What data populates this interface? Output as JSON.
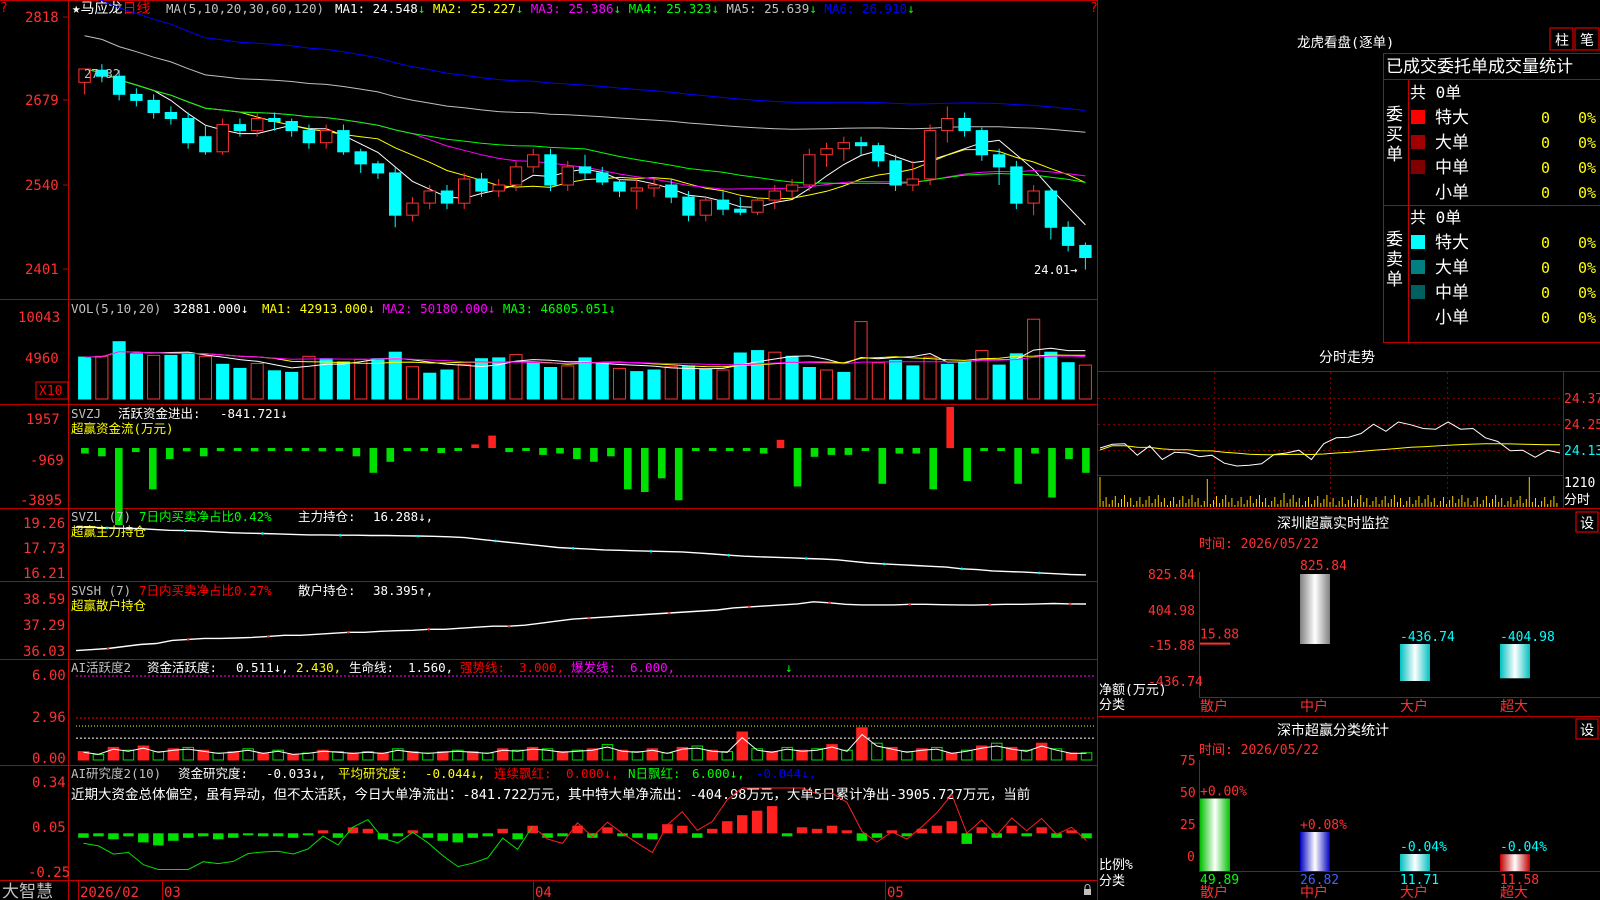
{
  "main_chart": {
    "name": "马应龙",
    "period": "日线",
    "ma_params": "MA(5,10,20,30,60,120)",
    "ma_values": [
      {
        "label": "MA1:",
        "value": "24.548",
        "arrow": "↓",
        "color": "#ffffff"
      },
      {
        "label": "MA2:",
        "value": "25.227",
        "arrow": "↓",
        "color": "#ffff00"
      },
      {
        "label": "MA3:",
        "value": "25.386",
        "arrow": "↓",
        "color": "#ff00ff"
      },
      {
        "label": "MA4:",
        "value": "25.323",
        "arrow": "↓",
        "color": "#00ff00"
      },
      {
        "label": "MA5:",
        "value": "25.639",
        "arrow": "↓",
        "color": "#c0c0c0"
      },
      {
        "label": "MA6:",
        "value": "26.910",
        "arrow": "↓",
        "color": "#0000ff"
      }
    ],
    "y_ticks": [
      "2818",
      "2679",
      "2540",
      "2401"
    ],
    "high_label": "27.32",
    "low_label": "24.01→"
  },
  "vol_panel": {
    "title": "VOL(5,10,20)",
    "value": "32881.000↓",
    "ma": [
      {
        "label": "MA1:",
        "value": "42913.000↓",
        "color": "#ffff00"
      },
      {
        "label": "MA2:",
        "value": "50180.000↓",
        "color": "#ff00ff"
      },
      {
        "label": "MA3:",
        "value": "46805.051↓",
        "color": "#00ff00"
      }
    ],
    "y_ticks": [
      "10043",
      "4960"
    ],
    "unit_badge": "X10"
  },
  "svzj_panel": {
    "title": "SVZJ",
    "label": "活跃资金进出:",
    "value": "-841.721↓",
    "subtitle": "超赢资金流(万元)",
    "y_ticks": [
      "1957",
      "-969",
      "-3895"
    ]
  },
  "svzl_panel": {
    "title": "SVZL (7)",
    "label1": "7日内买卖净占比0.42%",
    "label2": "主力持仓:",
    "value": "16.288↓,",
    "subtitle": "超赢主力持仓",
    "y_ticks": [
      "19.26",
      "17.73",
      "16.21"
    ]
  },
  "svsh_panel": {
    "title": "SVSH (7)",
    "label1": "7日内买卖净占比0.27%",
    "label2": "散户持仓:",
    "value": "38.395↑,",
    "subtitle": "超赢散户持仓",
    "y_ticks": [
      "38.59",
      "37.29",
      "36.03"
    ]
  },
  "ai_active_panel": {
    "title": "AI活跃度2",
    "label1": "资金活跃度:",
    "value1": "0.511↓,",
    "value2": "2.430,",
    "label3": "生命线:",
    "value3": "1.560,",
    "label4": "强势线:",
    "value4": "3.000,",
    "label5": "爆发线:",
    "value5": "6.000,",
    "arrow": "↓",
    "y_ticks": [
      "6.00",
      "2.96",
      "0.00"
    ]
  },
  "ai_research_panel": {
    "title": "AI研究度2(10)",
    "label1": "资金研究度:",
    "value1": "-0.033↓,",
    "label2": "平均研究度:",
    "value2": "-0.044↓,",
    "label3": "连续飘红:",
    "value3": "0.000↓,",
    "label4": "N日飘红:",
    "value4": "6.000↓,",
    "value5": "-0.044↓,",
    "commentary": "近期大资金总体偏空，虽有异动，但不太活跃，今日大单净流出：-841.722万元，其中特大单净流出：-404.98万元，大单5日累计净出-3905.727万元，当前",
    "y_ticks": [
      "0.34",
      "0.05",
      "-0.25"
    ]
  },
  "x_axis": {
    "logo": "大智慧",
    "labels": [
      "2026/02",
      "03",
      "04",
      "05"
    ]
  },
  "dragon_tiger": {
    "title": "龙虎看盘(逐单)",
    "btn_bar": "柱",
    "btn_pen": "笔",
    "header": "已成交委托单成交量统计",
    "buy": {
      "side_label": "委买单",
      "total": "共 0单",
      "rows": [
        {
          "label": "特大",
          "count": "0",
          "pct": "0%",
          "color": "#ff0000"
        },
        {
          "label": "大单",
          "count": "0",
          "pct": "0%",
          "color": "#a00000"
        },
        {
          "label": "中单",
          "count": "0",
          "pct": "0%",
          "color": "#800000"
        },
        {
          "label": "小单",
          "count": "0",
          "pct": "0%",
          "color": ""
        }
      ]
    },
    "sell": {
      "side_label": "委卖单",
      "total": "共 0单",
      "rows": [
        {
          "label": "特大",
          "count": "0",
          "pct": "0%",
          "color": "#00ffff"
        },
        {
          "label": "大单",
          "count": "0",
          "pct": "0%",
          "color": "#008080"
        },
        {
          "label": "中单",
          "count": "0",
          "pct": "0%",
          "color": "#006060"
        },
        {
          "label": "小单",
          "count": "0",
          "pct": "0%",
          "color": ""
        }
      ]
    }
  },
  "intraday": {
    "title": "分时走势",
    "y_ticks": [
      "24.37",
      "24.25",
      "24.13"
    ],
    "vol_tick": "1210",
    "vol_label": "分时"
  },
  "sz_monitor": {
    "title": "深圳超赢实时监控",
    "btn": "设",
    "time": "时间: 2026/05/22",
    "y_ticks": [
      "825.84",
      "404.98",
      "-15.88",
      "-436.74"
    ],
    "y_unit": "净额(万元)",
    "y_unit2": "分类",
    "categories": [
      "散户",
      "中户",
      "大户",
      "超大"
    ]
  },
  "sz_class": {
    "title": "深市超赢分类统计",
    "btn": "设",
    "time": "时间: 2026/05/22",
    "y_ticks": [
      "75",
      "50",
      "25",
      "0"
    ],
    "y_unit": "比例%",
    "y_unit2": "分类",
    "categories": [
      "散户",
      "中户",
      "大户",
      "超大"
    ]
  },
  "chart_data": [
    {
      "type": "candlestick",
      "title": "马应龙 日线",
      "ylim": [
        24.01,
        28.18
      ],
      "annotations": [
        "27.32",
        "24.01"
      ],
      "x_labels": [
        "2026/02",
        "03",
        "04",
        "05"
      ],
      "ohlc": [
        [
          27.1,
          27.3,
          26.9,
          27.32
        ],
        [
          27.3,
          27.4,
          27.1,
          27.2
        ],
        [
          27.2,
          27.3,
          26.8,
          26.9
        ],
        [
          26.9,
          27.0,
          26.7,
          26.8
        ],
        [
          26.8,
          26.9,
          26.5,
          26.6
        ],
        [
          26.6,
          26.7,
          26.4,
          26.5
        ],
        [
          26.5,
          26.6,
          26.0,
          26.1
        ],
        [
          26.2,
          26.4,
          25.9,
          25.95
        ],
        [
          25.95,
          26.5,
          25.9,
          26.4
        ],
        [
          26.4,
          26.5,
          26.2,
          26.3
        ],
        [
          26.3,
          26.6,
          26.2,
          26.5
        ],
        [
          26.5,
          26.6,
          26.3,
          26.45
        ],
        [
          26.45,
          26.5,
          26.2,
          26.3
        ],
        [
          26.3,
          26.4,
          26.0,
          26.1
        ],
        [
          26.1,
          26.4,
          26.0,
          26.3
        ],
        [
          26.3,
          26.4,
          25.9,
          25.95
        ],
        [
          25.95,
          26.0,
          25.6,
          25.75
        ],
        [
          25.75,
          25.8,
          25.5,
          25.6
        ],
        [
          25.6,
          25.7,
          24.7,
          24.9
        ],
        [
          24.9,
          25.2,
          24.8,
          25.1
        ],
        [
          25.1,
          25.4,
          25.0,
          25.3
        ],
        [
          25.3,
          25.4,
          25.0,
          25.1
        ],
        [
          25.1,
          25.6,
          25.0,
          25.5
        ],
        [
          25.5,
          25.6,
          25.2,
          25.3
        ],
        [
          25.3,
          25.5,
          25.2,
          25.4
        ],
        [
          25.4,
          25.8,
          25.3,
          25.7
        ],
        [
          25.7,
          26.0,
          25.6,
          25.9
        ],
        [
          25.9,
          26.0,
          25.3,
          25.4
        ],
        [
          25.4,
          25.8,
          25.3,
          25.7
        ],
        [
          25.7,
          25.9,
          25.5,
          25.6
        ],
        [
          25.6,
          25.7,
          25.4,
          25.45
        ],
        [
          25.45,
          25.5,
          25.2,
          25.3
        ],
        [
          25.3,
          25.5,
          25.0,
          25.35
        ],
        [
          25.35,
          25.5,
          25.2,
          25.4
        ],
        [
          25.4,
          25.5,
          25.1,
          25.2
        ],
        [
          25.2,
          25.3,
          24.8,
          24.9
        ],
        [
          24.9,
          25.2,
          24.8,
          25.15
        ],
        [
          25.15,
          25.3,
          24.9,
          25.0
        ],
        [
          25.0,
          25.2,
          24.9,
          24.95
        ],
        [
          24.95,
          25.2,
          24.9,
          25.15
        ],
        [
          25.15,
          25.4,
          25.0,
          25.3
        ],
        [
          25.3,
          25.5,
          25.2,
          25.4
        ],
        [
          25.4,
          26.0,
          25.3,
          25.9
        ],
        [
          25.9,
          26.1,
          25.7,
          26.0
        ],
        [
          26.0,
          26.2,
          25.8,
          26.1
        ],
        [
          26.1,
          26.2,
          25.9,
          26.05
        ],
        [
          26.05,
          26.1,
          25.7,
          25.8
        ],
        [
          25.8,
          25.9,
          25.3,
          25.4
        ],
        [
          25.4,
          25.8,
          25.3,
          25.5
        ],
        [
          25.5,
          26.4,
          25.4,
          26.3
        ],
        [
          26.3,
          26.7,
          26.1,
          26.5
        ],
        [
          26.5,
          26.6,
          26.2,
          26.3
        ],
        [
          26.3,
          26.35,
          25.8,
          25.9
        ],
        [
          25.9,
          26.0,
          25.4,
          25.7
        ],
        [
          25.7,
          25.8,
          25.0,
          25.1
        ],
        [
          25.1,
          25.4,
          24.9,
          25.3
        ],
        [
          25.3,
          25.35,
          24.5,
          24.7
        ],
        [
          24.7,
          24.8,
          24.3,
          24.4
        ],
        [
          24.4,
          24.45,
          24.0,
          24.2
        ]
      ]
    },
    {
      "type": "bar",
      "title": "VOL(5,10,20)",
      "ylim": [
        0,
        10043
      ],
      "values": [
        5200,
        5300,
        7100,
        5600,
        5400,
        5400,
        5600,
        5300,
        4300,
        3800,
        4400,
        3500,
        3300,
        5300,
        5000,
        4600,
        4900,
        5000,
        5800,
        4000,
        3200,
        3600,
        4300,
        5000,
        5100,
        5500,
        4500,
        3900,
        4100,
        5100,
        4500,
        3800,
        3400,
        3600,
        4000,
        4100,
        3700,
        3600,
        5700,
        6000,
        5800,
        5300,
        3900,
        3600,
        3300,
        9600,
        4500,
        4800,
        4100,
        5200,
        4300,
        4600,
        6000,
        4200,
        5600,
        9900,
        5800,
        4500,
        4200
      ]
    },
    {
      "type": "bar",
      "title": "超赢资金流(万元)",
      "ylim": [
        -3895,
        1957
      ],
      "values": [
        -200,
        -300,
        -2800,
        -150,
        -1500,
        -400,
        -120,
        -300,
        -80,
        -20,
        -120,
        -50,
        -10,
        -50,
        -120,
        -100,
        -300,
        -900,
        -500,
        -50,
        -100,
        -180,
        -80,
        130,
        450,
        -150,
        -100,
        -250,
        -200,
        -400,
        -500,
        -300,
        -1500,
        -1600,
        -1100,
        -1900,
        -100,
        -40,
        -100,
        -100,
        -200,
        300,
        -1400,
        -320,
        -250,
        -250,
        -100,
        -1300,
        -200,
        -200,
        -1500,
        1500,
        -1200,
        -40,
        -100,
        -1300,
        -200,
        -1800,
        -400,
        -900
      ]
    },
    {
      "type": "line",
      "title": "超赢主力持仓",
      "ylim": [
        16.21,
        19.26
      ],
      "values": [
        19.2,
        19.18,
        19.15,
        19.12,
        19.1,
        19.05,
        19.0,
        18.98,
        18.95,
        18.9,
        18.85,
        18.82,
        18.8,
        18.78,
        18.75,
        18.72,
        18.72,
        18.7,
        18.7,
        18.68,
        18.68,
        18.66,
        18.65,
        18.63,
        18.6,
        18.55,
        18.45,
        18.35,
        18.25,
        18.15,
        18.05,
        17.95,
        17.9,
        17.85,
        17.8,
        17.78,
        17.75,
        17.72,
        17.7,
        17.68,
        17.62,
        17.55,
        17.48,
        17.42,
        17.38,
        17.35,
        17.32,
        17.28,
        17.25,
        17.2,
        17.1,
        17.0,
        16.95,
        16.9,
        16.85,
        16.8,
        16.75,
        16.65,
        16.6,
        16.52,
        16.48,
        16.45,
        16.4,
        16.35,
        16.3,
        16.28
      ]
    },
    {
      "type": "line",
      "title": "超赢散户持仓",
      "ylim": [
        36.03,
        38.59
      ],
      "values": [
        36.1,
        36.15,
        36.2,
        36.3,
        36.4,
        36.45,
        36.6,
        36.65,
        36.7,
        36.7,
        36.72,
        36.75,
        36.8,
        36.85,
        36.85,
        36.9,
        36.95,
        37.0,
        37.0,
        37.05,
        37.08,
        37.1,
        37.15,
        37.15,
        37.2,
        37.25,
        37.3,
        37.3,
        37.35,
        37.45,
        37.55,
        37.65,
        37.7,
        37.75,
        37.8,
        37.85,
        37.9,
        37.95,
        38.0,
        38.05,
        38.1,
        38.2,
        38.25,
        38.3,
        38.35,
        38.4,
        38.5,
        38.45,
        38.38,
        38.35,
        38.35,
        38.35,
        38.38,
        38.38,
        38.36,
        38.35,
        38.34,
        38.36,
        38.38,
        38.38,
        38.4,
        38.42,
        38.4,
        38.395
      ]
    },
    {
      "type": "bar",
      "title": "AI活跃度2",
      "ylim": [
        0,
        6.0
      ],
      "values": [
        0.6,
        0.4,
        0.9,
        0.7,
        1.0,
        0.6,
        0.8,
        0.9,
        0.7,
        0.5,
        0.6,
        0.8,
        0.5,
        0.7,
        0.4,
        0.5,
        0.7,
        0.6,
        0.5,
        0.6,
        0.5,
        0.8,
        0.6,
        0.5,
        0.6,
        0.7,
        0.6,
        0.5,
        0.8,
        0.7,
        0.9,
        0.8,
        0.6,
        0.7,
        0.8,
        1.1,
        0.7,
        0.6,
        0.8,
        0.5,
        0.9,
        1.0,
        0.7,
        0.6,
        2.0,
        0.8,
        0.6,
        0.9,
        0.7,
        0.8,
        1.1,
        0.7,
        2.3,
        1.2,
        0.9,
        0.6,
        0.8,
        0.9,
        0.5,
        0.7,
        1.0,
        1.2,
        0.9,
        0.7,
        1.2,
        0.8,
        0.5,
        0.511
      ]
    },
    {
      "type": "bar",
      "title": "AI研究度2(10)",
      "ylim": [
        -0.25,
        0.34
      ],
      "values": [
        -0.03,
        -0.02,
        -0.04,
        -0.02,
        -0.06,
        -0.08,
        -0.05,
        -0.03,
        -0.02,
        -0.04,
        -0.03,
        -0.01,
        -0.02,
        -0.02,
        -0.03,
        -0.01,
        0.02,
        -0.03,
        0.04,
        0.03,
        -0.04,
        -0.02,
        0.02,
        -0.03,
        -0.05,
        -0.06,
        -0.03,
        -0.02,
        0.03,
        -0.04,
        0.05,
        -0.03,
        -0.02,
        0.05,
        -0.03,
        0.04,
        -0.02,
        -0.03,
        -0.04,
        0.06,
        0.05,
        -0.03,
        0.03,
        0.08,
        0.12,
        0.15,
        0.18,
        -0.02,
        0.04,
        0.03,
        0.05,
        0.02,
        -0.05,
        -0.03,
        0.02,
        -0.02,
        0.03,
        0.05,
        0.08,
        -0.07,
        0.04,
        -0.03,
        0.05,
        -0.02,
        0.04,
        -0.03,
        0.02,
        -0.033
      ]
    },
    {
      "type": "line",
      "title": "分时走势",
      "ylim": [
        24.01,
        24.37
      ],
      "values": [
        24.13,
        24.17,
        24.15,
        24.12,
        24.14,
        24.1,
        24.11,
        24.13,
        24.09,
        24.12,
        24.06,
        24.07,
        24.05,
        24.08,
        24.1,
        24.13,
        24.12,
        24.1,
        24.15,
        24.2,
        24.18,
        24.22,
        24.24,
        24.23,
        24.25,
        24.26,
        24.22,
        24.24,
        24.25,
        24.24,
        24.22,
        24.2,
        24.16,
        24.14,
        24.12,
        24.11,
        24.12,
        24.13
      ]
    },
    {
      "type": "bar",
      "title": "深圳超赢实时监控",
      "categories": [
        "散户",
        "中户",
        "大户",
        "超大"
      ],
      "values": [
        15.88,
        825.84,
        -436.74,
        -404.98
      ],
      "ylim": [
        -436.74,
        825.84
      ]
    },
    {
      "type": "bar",
      "title": "深市超赢分类统计",
      "categories": [
        "散户",
        "中户",
        "大户",
        "超大"
      ],
      "values": [
        49.89,
        26.82,
        11.71,
        11.58
      ],
      "changes": [
        "+0.00%",
        "+0.08%",
        "-0.04%",
        "-0.04%"
      ],
      "ylim": [
        0,
        75
      ]
    }
  ]
}
